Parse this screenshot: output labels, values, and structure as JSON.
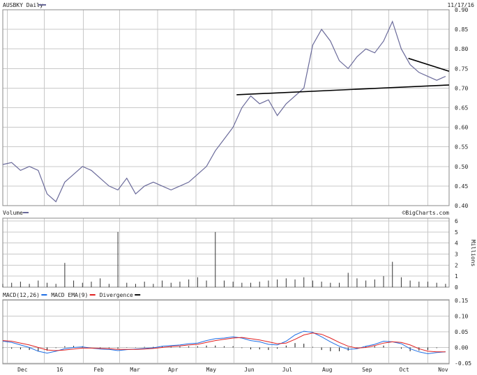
{
  "header": {
    "symbol_label": "AUSBKY Daily",
    "date_label": "11/17/16"
  },
  "volume_panel": {
    "label": "Volume",
    "source": "©BigCharts.com",
    "unit_label": "Millions"
  },
  "macd_panel": {
    "legend": [
      {
        "text": "MACD(12,26)",
        "color": "#1f6fe5"
      },
      {
        "text": "MACD EMA(9)",
        "color": "#e02020"
      },
      {
        "text": "Divergence",
        "color": "#111111"
      }
    ]
  },
  "colors": {
    "price_line": "#6a6a9a",
    "trendline": "#000000",
    "volume_bar": "#333333",
    "macd_line": "#1f6fe5",
    "signal_line": "#e02020",
    "divergence_bar": "#111111"
  },
  "x_axis": {
    "months": [
      "Dec",
      "16",
      "Feb",
      "Mar",
      "Apr",
      "May",
      "Jun",
      "Jul",
      "Aug",
      "Sep",
      "Oct",
      "Nov"
    ],
    "month_positions": [
      0.5,
      4.7,
      9.1,
      13.2,
      17.5,
      21.8,
      26.1,
      30.4,
      34.9,
      39.4,
      43.6,
      48.0
    ]
  },
  "chart_data": [
    {
      "type": "line",
      "title": "AUSBKY Daily",
      "ylim": [
        0.4,
        0.9
      ],
      "yticks": [
        "0.90",
        "0.85",
        "0.80",
        "0.75",
        "0.70",
        "0.65",
        "0.60",
        "0.55",
        "0.50",
        "0.45",
        "0.40"
      ],
      "grid": true,
      "x_weeks": [
        0,
        1,
        2,
        3,
        4,
        5,
        6,
        7,
        8,
        9,
        10,
        11,
        12,
        13,
        14,
        15,
        16,
        17,
        18,
        19,
        20,
        21,
        22,
        23,
        24,
        25,
        26,
        27,
        28,
        29,
        30,
        31,
        32,
        33,
        34,
        35,
        36,
        37,
        38,
        39,
        40,
        41,
        42,
        43,
        44,
        45,
        46,
        47,
        48,
        49,
        50
      ],
      "series": [
        {
          "values": [
            0.505,
            0.51,
            0.49,
            0.5,
            0.49,
            0.43,
            0.41,
            0.46,
            0.48,
            0.5,
            0.49,
            0.47,
            0.45,
            0.44,
            0.47,
            0.43,
            0.45,
            0.46,
            0.45,
            0.44,
            0.45,
            0.46,
            0.48,
            0.5,
            0.54,
            0.57,
            0.6,
            0.65,
            0.68,
            0.66,
            0.67,
            0.63,
            0.66,
            0.68,
            0.7,
            0.81,
            0.85,
            0.82,
            0.77,
            0.75,
            0.78,
            0.8,
            0.79,
            0.82,
            0.87,
            0.8,
            0.76,
            0.74,
            0.73,
            0.72,
            0.73
          ]
        }
      ],
      "trendlines": [
        {
          "from": [
            26.4,
            0.683
          ],
          "to": [
            50.4,
            0.708
          ]
        },
        {
          "from": [
            45.8,
            0.776
          ],
          "to": [
            50.4,
            0.743
          ]
        }
      ]
    },
    {
      "type": "bar",
      "title": "Volume",
      "ylabel": "Millions",
      "ylim": [
        0,
        6
      ],
      "yticks": [
        "6",
        "5",
        "4",
        "3",
        "2",
        "1",
        "0"
      ],
      "x_weeks": [
        0,
        1,
        2,
        3,
        4,
        5,
        6,
        7,
        8,
        9,
        10,
        11,
        12,
        13,
        14,
        15,
        16,
        17,
        18,
        19,
        20,
        21,
        22,
        23,
        24,
        25,
        26,
        27,
        28,
        29,
        30,
        31,
        32,
        33,
        34,
        35,
        36,
        37,
        38,
        39,
        40,
        41,
        42,
        43,
        44,
        45,
        46,
        47,
        48,
        49,
        50
      ],
      "values": [
        0.3,
        0.4,
        0.5,
        0.3,
        0.6,
        0.4,
        0.3,
        2.2,
        0.6,
        0.4,
        0.5,
        0.8,
        0.3,
        5.0,
        0.4,
        0.3,
        0.5,
        0.3,
        0.6,
        0.4,
        0.5,
        0.7,
        0.9,
        0.6,
        5.0,
        0.6,
        0.5,
        0.4,
        0.4,
        0.5,
        0.6,
        0.7,
        0.8,
        0.7,
        0.9,
        0.6,
        0.5,
        0.4,
        0.4,
        1.3,
        0.8,
        0.6,
        0.7,
        1.0,
        2.3,
        0.9,
        0.6,
        0.5,
        0.5,
        0.4,
        0.3
      ]
    },
    {
      "type": "line",
      "title": "MACD(12,26)",
      "ylim": [
        -0.05,
        0.15
      ],
      "yticks": [
        "0.15",
        "0.10",
        "0.05",
        "0.00",
        "-0.05"
      ],
      "x_weeks": [
        0,
        1,
        2,
        3,
        4,
        5,
        6,
        7,
        8,
        9,
        10,
        11,
        12,
        13,
        14,
        15,
        16,
        17,
        18,
        19,
        20,
        21,
        22,
        23,
        24,
        25,
        26,
        27,
        28,
        29,
        30,
        31,
        32,
        33,
        34,
        35,
        36,
        37,
        38,
        39,
        40,
        41,
        42,
        43,
        44,
        45,
        46,
        47,
        48,
        49,
        50
      ],
      "series": [
        {
          "name": "MACD(12,26)",
          "values": [
            0.02,
            0.016,
            0.008,
            0.0,
            -0.012,
            -0.018,
            -0.012,
            -0.004,
            0.0,
            0.002,
            -0.002,
            -0.005,
            -0.006,
            -0.01,
            -0.007,
            -0.005,
            -0.003,
            -0.001,
            0.004,
            0.006,
            0.008,
            0.012,
            0.014,
            0.022,
            0.028,
            0.03,
            0.034,
            0.03,
            0.022,
            0.018,
            0.01,
            0.008,
            0.02,
            0.04,
            0.052,
            0.048,
            0.034,
            0.018,
            0.004,
            -0.006,
            -0.004,
            0.004,
            0.01,
            0.02,
            0.018,
            0.012,
            -0.004,
            -0.014,
            -0.02,
            -0.016,
            -0.014
          ]
        },
        {
          "name": "MACD EMA(9)",
          "values": [
            0.022,
            0.02,
            0.014,
            0.008,
            0.0,
            -0.008,
            -0.01,
            -0.008,
            -0.005,
            -0.002,
            -0.002,
            -0.003,
            -0.004,
            -0.006,
            -0.006,
            -0.006,
            -0.005,
            -0.003,
            0.0,
            0.003,
            0.005,
            0.008,
            0.01,
            0.016,
            0.022,
            0.026,
            0.03,
            0.032,
            0.028,
            0.024,
            0.018,
            0.012,
            0.014,
            0.026,
            0.04,
            0.046,
            0.042,
            0.03,
            0.016,
            0.004,
            -0.002,
            0.0,
            0.006,
            0.014,
            0.018,
            0.016,
            0.008,
            -0.004,
            -0.012,
            -0.014,
            -0.014
          ]
        }
      ],
      "divergence": [
        -0.002,
        -0.004,
        -0.006,
        -0.008,
        -0.012,
        -0.01,
        -0.002,
        0.004,
        0.005,
        0.004,
        0.0,
        -0.002,
        -0.002,
        -0.004,
        -0.001,
        0.001,
        0.002,
        0.002,
        0.004,
        0.003,
        0.003,
        0.004,
        0.004,
        0.006,
        0.006,
        0.004,
        0.004,
        -0.002,
        -0.006,
        -0.006,
        -0.008,
        -0.004,
        0.006,
        0.014,
        0.012,
        0.002,
        -0.008,
        -0.012,
        -0.012,
        -0.01,
        -0.002,
        0.004,
        0.004,
        0.006,
        0.0,
        -0.004,
        -0.012,
        -0.01,
        -0.008,
        -0.002,
        0.0
      ]
    }
  ]
}
